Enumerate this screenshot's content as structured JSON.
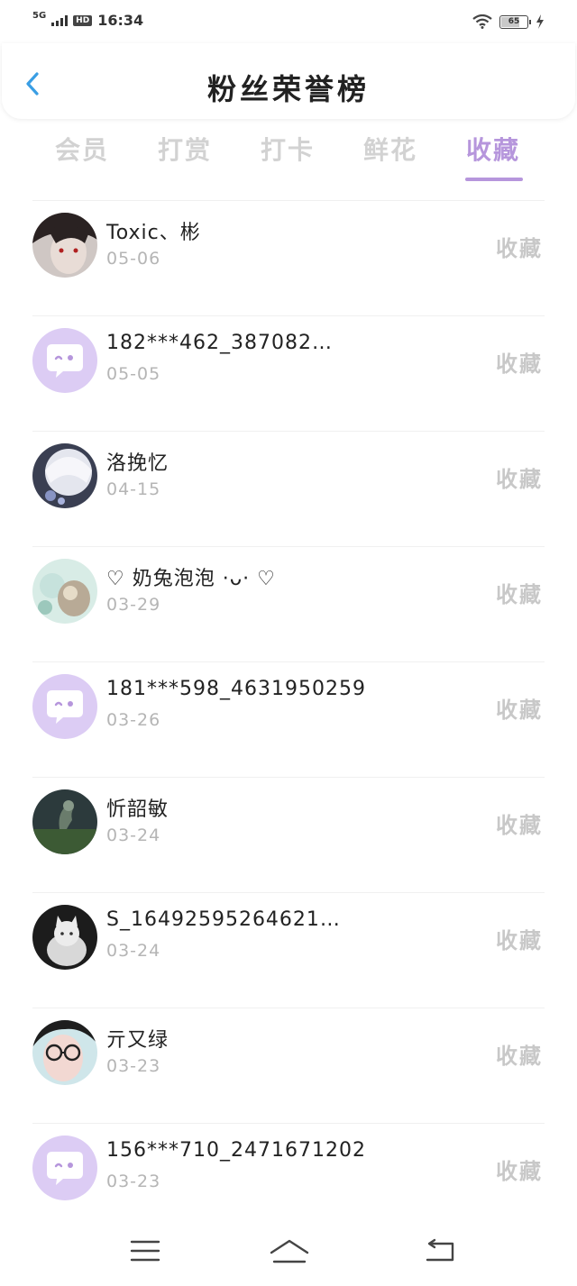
{
  "status_bar": {
    "network": "5G",
    "hd": "HD",
    "time": "16:34",
    "battery": "65"
  },
  "header": {
    "title": "粉丝荣誉榜"
  },
  "tabs": [
    {
      "label": "会员",
      "active": false
    },
    {
      "label": "打赏",
      "active": false
    },
    {
      "label": "打卡",
      "active": false
    },
    {
      "label": "鲜花",
      "active": false
    },
    {
      "label": "收藏",
      "active": true
    }
  ],
  "colors": {
    "accent": "#b696dc",
    "tab_inactive": "#d2d2d2",
    "date_text": "#b5b5b5",
    "action_text": "#c8c8c8",
    "default_avatar_bg": "#dcccf4"
  },
  "fans": [
    {
      "name": "Toxic、彬",
      "date": "05-06",
      "action": "收藏",
      "avatar": "photo-dark-hair-avatar"
    },
    {
      "name": "182***462_387082…",
      "date": "05-05",
      "action": "收藏",
      "avatar": "default-chat-avatar"
    },
    {
      "name": "洛挽忆",
      "date": "04-15",
      "action": "收藏",
      "avatar": "photo-anime-white-avatar"
    },
    {
      "name": "♡ 奶兔泡泡 ·ᴗ· ♡",
      "date": "03-29",
      "action": "收藏",
      "avatar": "photo-pastel-avatar"
    },
    {
      "name": "181***598_4631950259",
      "date": "03-26",
      "action": "收藏",
      "avatar": "default-chat-avatar"
    },
    {
      "name": "忻韶敏",
      "date": "03-24",
      "action": "收藏",
      "avatar": "photo-dark-landscape-avatar"
    },
    {
      "name": "S_16492595264621…",
      "date": "03-24",
      "action": "收藏",
      "avatar": "photo-white-cat-avatar"
    },
    {
      "name": "亓又绿",
      "date": "03-23",
      "action": "收藏",
      "avatar": "photo-glasses-avatar"
    },
    {
      "name": "156***710_2471671202",
      "date": "03-23",
      "action": "收藏",
      "avatar": "default-chat-avatar"
    }
  ],
  "nav": {
    "menu_icon": "menu-icon",
    "home_icon": "home-icon",
    "back_icon": "back-icon"
  }
}
